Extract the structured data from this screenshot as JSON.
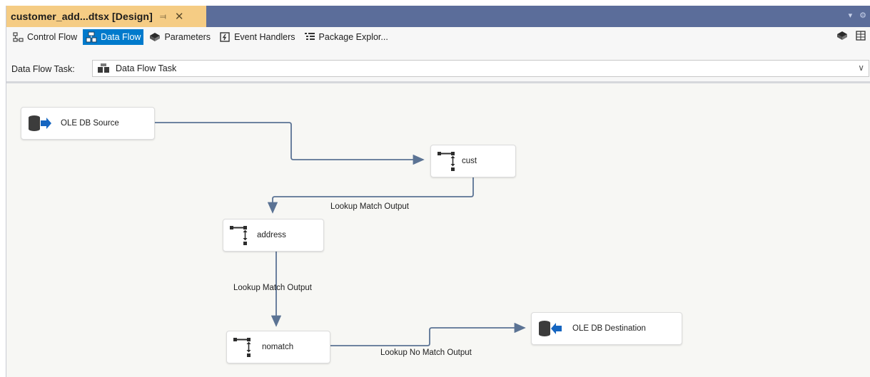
{
  "document_tab": {
    "title": "customer_add...dtsx [Design]",
    "pin_icon": "pin-icon",
    "close_icon": "close-icon"
  },
  "designer_tabs": [
    {
      "label": "Control Flow",
      "icon": "control-flow-icon",
      "active": false
    },
    {
      "label": "Data Flow",
      "icon": "data-flow-icon",
      "active": true
    },
    {
      "label": "Parameters",
      "icon": "parameters-icon",
      "active": false
    },
    {
      "label": "Event Handlers",
      "icon": "event-handlers-icon",
      "active": false
    },
    {
      "label": "Package Explor...",
      "icon": "package-explorer-icon",
      "active": false
    }
  ],
  "task_selector": {
    "label": "Data Flow Task:",
    "value": "Data Flow Task"
  },
  "components": {
    "ole_db_source": "OLE DB Source",
    "cust": "cust",
    "address": "address",
    "nomatch": "nomatch",
    "ole_db_destination": "OLE DB Destination"
  },
  "paths": {
    "cust_to_address": "Lookup Match Output",
    "address_to_nomatch": "Lookup Match Output",
    "nomatch_to_destination": "Lookup No Match Output"
  },
  "colors": {
    "tab_strip": "#5b6d9a",
    "active_doc_tab": "#f5cc84",
    "active_designer_tab": "#007acc",
    "connector": "#5b7394"
  }
}
